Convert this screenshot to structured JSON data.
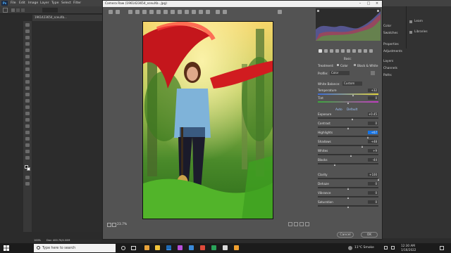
{
  "photoshop": {
    "logo": "Ps",
    "menus": [
      "File",
      "Edit",
      "Image",
      "Layer",
      "Type",
      "Select",
      "Filter"
    ],
    "doc_tab": "1961423654_sceuXb...",
    "status": "Doc: 400.7K/4.00M",
    "zoom": "100%",
    "right_panels": [
      "Color",
      "Swatches",
      "Properties",
      "Adjustments",
      "Layers",
      "Channels",
      "Paths",
      "Learn",
      "Libraries"
    ]
  },
  "camera_raw": {
    "title": "Camera Raw (1961423654_sceuXb...Jpg)",
    "zoom_value": "23.7%",
    "panel_tab": "Basic",
    "treatment_label": "Treatment:",
    "treatment_color": "Color",
    "treatment_bw": "Black & White",
    "profile_label": "Profile:",
    "profile_value": "Color",
    "wb_label": "White Balance:",
    "wb_value": "Custom",
    "temperature_label": "Temperature",
    "temperature_value": "+32",
    "tint_label": "Tint",
    "tint_value": "0",
    "auto_label": "Auto",
    "default_label": "Default",
    "sliders": [
      {
        "label": "Exposure",
        "value": "+0.45",
        "pos": 0.58
      },
      {
        "label": "Contrast",
        "value": "0",
        "pos": 0.5
      },
      {
        "label": "Highlights",
        "value": "+67",
        "pos": 0.83
      },
      {
        "label": "Shadows",
        "value": "+48",
        "pos": 0.74
      },
      {
        "label": "Whites",
        "value": "+9",
        "pos": 0.55
      },
      {
        "label": "Blacks",
        "value": "-44",
        "pos": 0.28
      },
      {
        "label": "Clarity",
        "value": "+100",
        "pos": 1.0
      },
      {
        "label": "Dehaze",
        "value": "0",
        "pos": 0.5
      },
      {
        "label": "Vibrance",
        "value": "0",
        "pos": 0.5
      },
      {
        "label": "Saturation",
        "value": "0",
        "pos": 0.5
      }
    ],
    "cancel_label": "Cancel",
    "ok_label": "OK"
  },
  "taskbar": {
    "search_placeholder": "Type here to search",
    "weather": "11°C  Smoke",
    "time": "12:30 AM",
    "date": "1/16/2022"
  },
  "colors": {
    "ps_bg": "#2b2b2b",
    "cr_bg": "#535353",
    "accent_blue": "#1473e6",
    "taskbar": "#1b1b1b"
  }
}
